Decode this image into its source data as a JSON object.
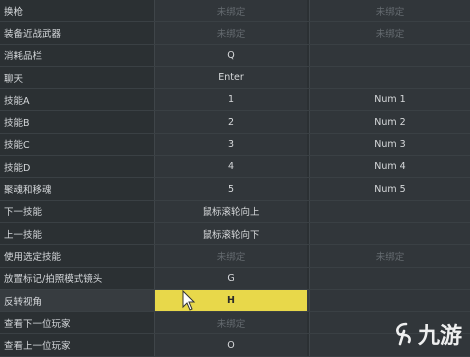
{
  "keybinds": [
    {
      "action": "换枪",
      "primary": "未绑定",
      "secondary": "未绑定"
    },
    {
      "action": "装备近战武器",
      "primary": "未绑定",
      "secondary": "未绑定"
    },
    {
      "action": "消耗品栏",
      "primary": "Q",
      "secondary": ""
    },
    {
      "action": "聊天",
      "primary": "Enter",
      "secondary": ""
    },
    {
      "action": "技能A",
      "primary": "1",
      "secondary": "Num 1"
    },
    {
      "action": "技能B",
      "primary": "2",
      "secondary": "Num 2"
    },
    {
      "action": "技能C",
      "primary": "3",
      "secondary": "Num 3"
    },
    {
      "action": "技能D",
      "primary": "4",
      "secondary": "Num 4"
    },
    {
      "action": "聚魂和移魂",
      "primary": "5",
      "secondary": "Num 5"
    },
    {
      "action": "下一技能",
      "primary": "鼠标滚轮向上",
      "secondary": ""
    },
    {
      "action": "上一技能",
      "primary": "鼠标滚轮向下",
      "secondary": ""
    },
    {
      "action": "使用选定技能",
      "primary": "未绑定",
      "secondary": "未绑定"
    },
    {
      "action": "放置标记/拍照模式镜头",
      "primary": "G",
      "secondary": ""
    },
    {
      "action": "反转视角",
      "primary": "H",
      "secondary": ""
    },
    {
      "action": "查看下一位玩家",
      "primary": "未绑定",
      "secondary": ""
    },
    {
      "action": "查看上一位玩家",
      "primary": "O",
      "secondary": ""
    }
  ],
  "selected_row": 13,
  "unbound_text": "未绑定",
  "colors": {
    "highlight": "#e8d84a",
    "background": "#2b3033"
  },
  "watermark": {
    "icon": "jiuyou-logo-icon",
    "text": "九游"
  }
}
